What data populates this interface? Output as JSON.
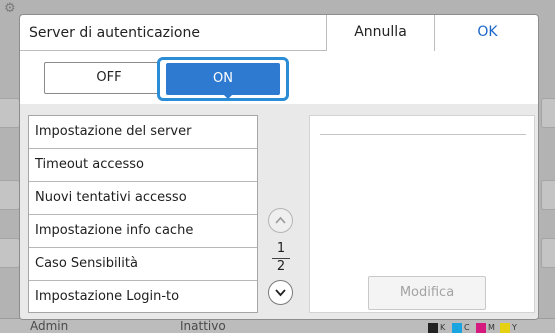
{
  "background": {
    "status_user": "Admin",
    "status_state": "Inattivo",
    "ink": [
      {
        "label": "K",
        "color": "#222222"
      },
      {
        "label": "C",
        "color": "#1aa5e0"
      },
      {
        "label": "M",
        "color": "#d6197f"
      },
      {
        "label": "Y",
        "color": "#e5d112"
      }
    ]
  },
  "dialog": {
    "title": "Server di autenticazione",
    "cancel_label": "Annulla",
    "ok_label": "OK",
    "toggle": {
      "off_label": "OFF",
      "on_label": "ON",
      "selected": "ON"
    },
    "settings_list": [
      {
        "label": "Impostazione del server"
      },
      {
        "label": "Timeout accesso"
      },
      {
        "label": "Nuovi tentativi accesso"
      },
      {
        "label": "Impostazione info cache"
      },
      {
        "label": "Caso Sensibilità"
      },
      {
        "label": "Impostazione Login-to"
      }
    ],
    "pagination": {
      "current": "1",
      "total": "2"
    },
    "detail": {
      "modify_label": "Modifica"
    }
  },
  "colors": {
    "accent": "#2e7ad1",
    "selection_ring": "#2b8dd6",
    "ok_text": "#1b64c8"
  },
  "icons": {
    "scroll_up": "chevron-up-icon",
    "scroll_down": "chevron-down-icon",
    "settings": "gear-icon"
  }
}
